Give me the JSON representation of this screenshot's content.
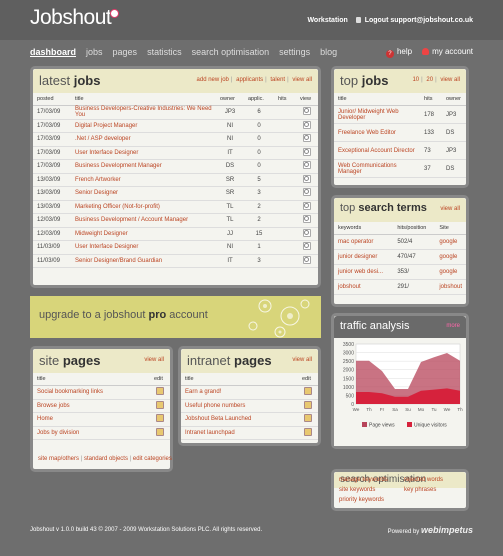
{
  "header": {
    "logo": "Jobshout",
    "workstation": "Workstation",
    "logout": "Logout support@jobshout.co.uk"
  },
  "nav": {
    "items": [
      "dashboard",
      "jobs",
      "pages",
      "statistics",
      "search optimisation",
      "settings",
      "blog"
    ],
    "help": "help",
    "account": "my account"
  },
  "latest_jobs": {
    "title_light": "latest",
    "title_bold": "jobs",
    "links": [
      "add new job",
      "applicants",
      "talent",
      "view all"
    ],
    "columns": [
      "posted",
      "title",
      "owner",
      "applic.",
      "hits",
      "view"
    ],
    "rows": [
      [
        "17/03/09",
        "Business Developers-Creative Industries: We Need You",
        "JP3",
        "6",
        ""
      ],
      [
        "17/03/09",
        "Digital Project Manager",
        "NI",
        "0",
        ""
      ],
      [
        "17/03/09",
        ".Net / ASP developer",
        "NI",
        "0",
        ""
      ],
      [
        "17/03/09",
        "User Interface Designer",
        "IT",
        "0",
        ""
      ],
      [
        "17/03/09",
        "Business Development Manager",
        "DS",
        "0",
        ""
      ],
      [
        "13/03/09",
        "French Artworker",
        "SR",
        "5",
        ""
      ],
      [
        "13/03/09",
        "Senior Designer",
        "SR",
        "3",
        ""
      ],
      [
        "13/03/09",
        "Marketing Officer (Not-for-profit)",
        "TL",
        "2",
        ""
      ],
      [
        "12/03/09",
        "Business Development / Account Manager",
        "TL",
        "2",
        ""
      ],
      [
        "12/03/09",
        "Midweight Designer",
        "JJ",
        "15",
        ""
      ],
      [
        "11/03/09",
        "User Interface Designer",
        "NI",
        "1",
        ""
      ],
      [
        "11/03/09",
        "Senior Designer/Brand Guardian",
        "IT",
        "3",
        ""
      ]
    ]
  },
  "promo": {
    "text_pre": "upgrade to a jobshout",
    "text_bold": "pro",
    "text_post": "account"
  },
  "site_pages": {
    "title_light": "site",
    "title_bold": "pages",
    "view_all": "view all",
    "columns": [
      "title",
      "edit"
    ],
    "rows": [
      "Social bookmarking links",
      "Browse jobs",
      "Home",
      "Jobs by division"
    ],
    "footer_links": [
      "site map/others",
      "standard objects",
      "edit categories"
    ]
  },
  "intranet_pages": {
    "title_light": "intranet",
    "title_bold": "pages",
    "view_all": "view all",
    "columns": [
      "title",
      "edit"
    ],
    "rows": [
      "Earn a grand!",
      "Useful phone numbers",
      "Jobshout Beta Launched",
      "Intranet launchpad"
    ]
  },
  "top_jobs": {
    "title_light": "top",
    "title_bold": "jobs",
    "links": [
      "10",
      "20",
      "view all"
    ],
    "columns": [
      "title",
      "hits",
      "owner"
    ],
    "rows": [
      [
        "Junior/ Midweight Web Developer",
        "178",
        "JP3"
      ],
      [
        "Freelance Web Editor",
        "133",
        "DS"
      ],
      [
        "Exceptional Account Director",
        "73",
        "JP3"
      ],
      [
        "Web Communications Manager",
        "37",
        "DS"
      ]
    ]
  },
  "top_search_terms": {
    "title_light": "top",
    "title_bold": "search terms",
    "view_all": "view all",
    "columns": [
      "keywords",
      "hits/position",
      "Site"
    ],
    "rows": [
      [
        "mac operator",
        "502/4",
        "google"
      ],
      [
        "junior designer",
        "470/47",
        "google"
      ],
      [
        "junior web desi...",
        "353/",
        "google"
      ],
      [
        "jobshout",
        "291/",
        "jobshout"
      ]
    ]
  },
  "traffic": {
    "title": "traffic analysis",
    "more": "more",
    "y_ticks": [
      "3500",
      "3000",
      "2500",
      "2000",
      "1500",
      "1000",
      "500",
      "0"
    ],
    "x_ticks": [
      "We",
      "Th",
      "Fr",
      "Sa",
      "Su",
      "Mo",
      "Tu",
      "We",
      "Th"
    ],
    "legend": [
      "Page views",
      "Unique visitors"
    ],
    "colors": {
      "page_views": "#b7445a",
      "unique_visitors": "#d6223c"
    }
  },
  "search_opt": {
    "title": "search optimisation",
    "links_left": [
      "manage keywords",
      "site keywords",
      "priority keywords"
    ],
    "links_right": [
      "rejected words",
      "key phrases"
    ]
  },
  "footer": {
    "text": "Jobshout v 1.0.0 build 43 © 2007 - 2009 Workstation Solutions PLC. All rights reserved.",
    "powered_by": "Powered by",
    "brand": "webimpetus"
  }
}
